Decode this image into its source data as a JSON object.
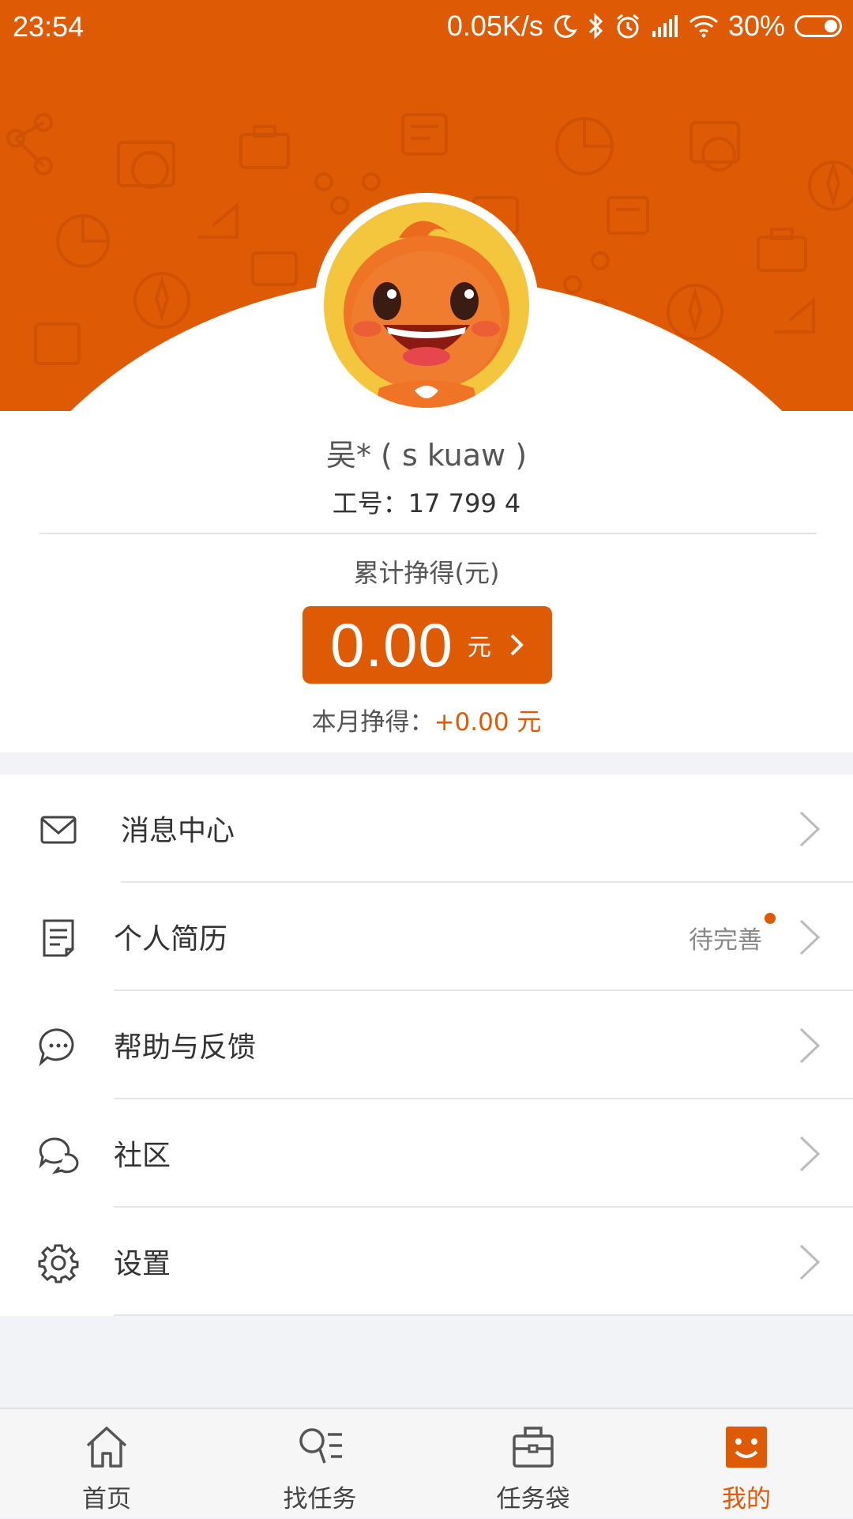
{
  "status_bar": {
    "time": "23:54",
    "net_speed": "0.05K/s",
    "battery": "30%",
    "icons": [
      "moon-icon",
      "bluetooth-icon",
      "alarm-icon",
      "signal-icon",
      "wifi-icon",
      "battery-icon"
    ]
  },
  "profile": {
    "name": "吴* ( s kuaw  )",
    "employee_no": "工号：17 799 4"
  },
  "earnings": {
    "total_label": "累计挣得(元)",
    "total_amount": "0.00",
    "total_unit": "元",
    "month_label": "本月挣得：",
    "month_value": "+0.00 元"
  },
  "menu": [
    {
      "label": "消息中心",
      "icon": "mail-icon"
    },
    {
      "label": "个人简历",
      "icon": "document-icon",
      "status": "待完善"
    },
    {
      "label": "帮助与反馈",
      "icon": "chat-bubble-icon"
    },
    {
      "label": "社区",
      "icon": "community-icon"
    },
    {
      "label": "设置",
      "icon": "gear-icon"
    }
  ],
  "tabs": [
    {
      "label": "首页",
      "icon": "home-icon"
    },
    {
      "label": "找任务",
      "icon": "search-list-icon"
    },
    {
      "label": "任务袋",
      "icon": "briefcase-icon"
    },
    {
      "label": "我的",
      "icon": "smiley-icon",
      "active": true
    }
  ],
  "colors": {
    "brand": "#df5a05",
    "avatar_bg": "#f4c63d",
    "page_bg": "#f2f3f6"
  }
}
